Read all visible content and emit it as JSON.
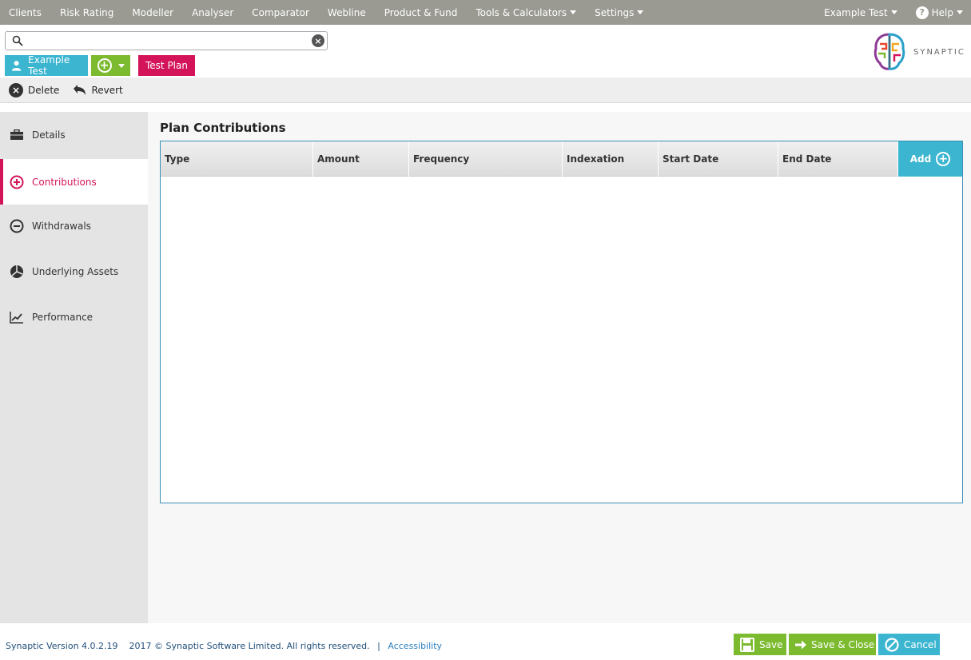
{
  "nav": {
    "items": [
      {
        "label": "Clients",
        "dropdown": false
      },
      {
        "label": "Risk Rating",
        "dropdown": false
      },
      {
        "label": "Modeller",
        "dropdown": false
      },
      {
        "label": "Analyser",
        "dropdown": false
      },
      {
        "label": "Comparator",
        "dropdown": false
      },
      {
        "label": "Webline",
        "dropdown": false
      },
      {
        "label": "Product & Fund",
        "dropdown": false
      },
      {
        "label": "Tools & Calculators",
        "dropdown": true
      },
      {
        "label": "Settings",
        "dropdown": true
      }
    ],
    "user": "Example Test",
    "help": "Help"
  },
  "search": {
    "value": "",
    "placeholder": ""
  },
  "logo": {
    "text": "SYNAPTIC"
  },
  "client": {
    "name": "Example Test"
  },
  "plan": {
    "name": "Test Plan"
  },
  "toolbar": {
    "delete": "Delete",
    "revert": "Revert"
  },
  "sidebar": {
    "items": [
      {
        "label": "Details",
        "icon": "briefcase-icon"
      },
      {
        "label": "Contributions",
        "icon": "plus-circle-icon",
        "active": true
      },
      {
        "label": "Withdrawals",
        "icon": "minus-circle-icon"
      },
      {
        "label": "Underlying Assets",
        "icon": "pie-chart-icon"
      },
      {
        "label": "Performance",
        "icon": "line-chart-icon"
      }
    ]
  },
  "main": {
    "title": "Plan Contributions",
    "columns": [
      "Type",
      "Amount",
      "Frequency",
      "Indexation",
      "Start Date",
      "End Date"
    ],
    "add_label": "Add",
    "rows": []
  },
  "footer": {
    "version": "Synaptic Version 4.0.2.19",
    "copyright": "2017 © Synaptic Software Limited. All rights reserved.",
    "separator": "|",
    "accessibility": "Accessibility",
    "save": "Save",
    "save_close": "Save & Close",
    "cancel": "Cancel"
  },
  "colors": {
    "nav_bg": "#9a9a92",
    "client": "#3bb5d0",
    "add": "#7cba2f",
    "plan": "#d4145a",
    "active": "#d4145a"
  }
}
